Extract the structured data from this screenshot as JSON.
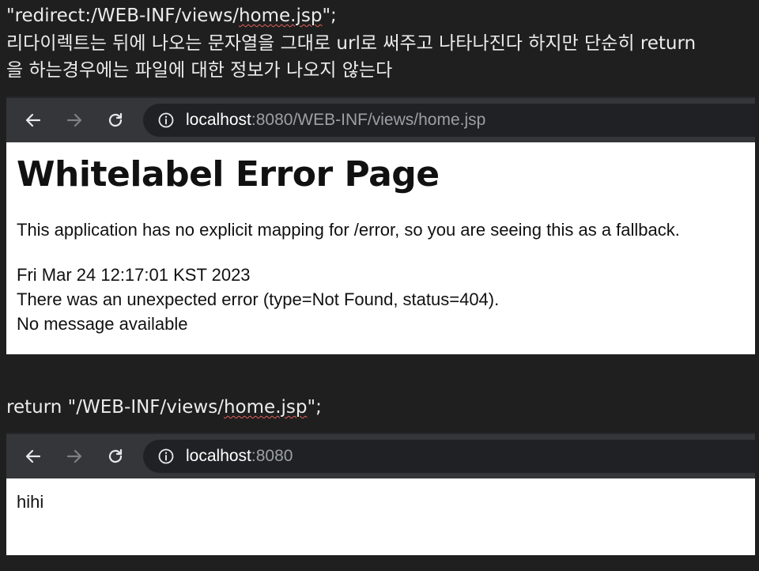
{
  "note1": {
    "line1_prefix": "\"redirect:/WEB-INF/views/",
    "line1_squiggle": "home.jsp",
    "line1_suffix": "\";",
    "line2": "리다이렉트는 뒤에 나오는 문자열을 그대로 url로 써주고 나타나진다 하지만 단순히 return",
    "line3": "을 하는경우에는 파일에 대한 정보가 나오지 않는다"
  },
  "browser1": {
    "url_host": "localhost",
    "url_rest": ":8080/WEB-INF/views/home.jsp",
    "page": {
      "title": "Whitelabel Error Page",
      "message": "This application has no explicit mapping for /error, so you are seeing this as a fallback.",
      "timestamp": "Fri Mar 24 12:17:01 KST 2023",
      "error_detail": "There was an unexpected error (type=Not Found, status=404).",
      "no_message": "No message available"
    }
  },
  "note2": {
    "prefix": "return \"/WEB-INF/views/",
    "squiggle": "home.jsp",
    "suffix": "\";"
  },
  "browser2": {
    "url_host": "localhost",
    "url_rest": ":8080",
    "page": {
      "body_text": "hihi"
    }
  },
  "icons": {
    "back": "arrow-left-icon",
    "forward": "arrow-right-icon",
    "reload": "reload-icon",
    "info": "info-circle-icon"
  },
  "colors": {
    "background": "#1f1f1f",
    "toolbar": "#35363a",
    "omnibox": "#202124",
    "url_muted": "#9aa0a6",
    "spell_underline": "#e0605a"
  }
}
